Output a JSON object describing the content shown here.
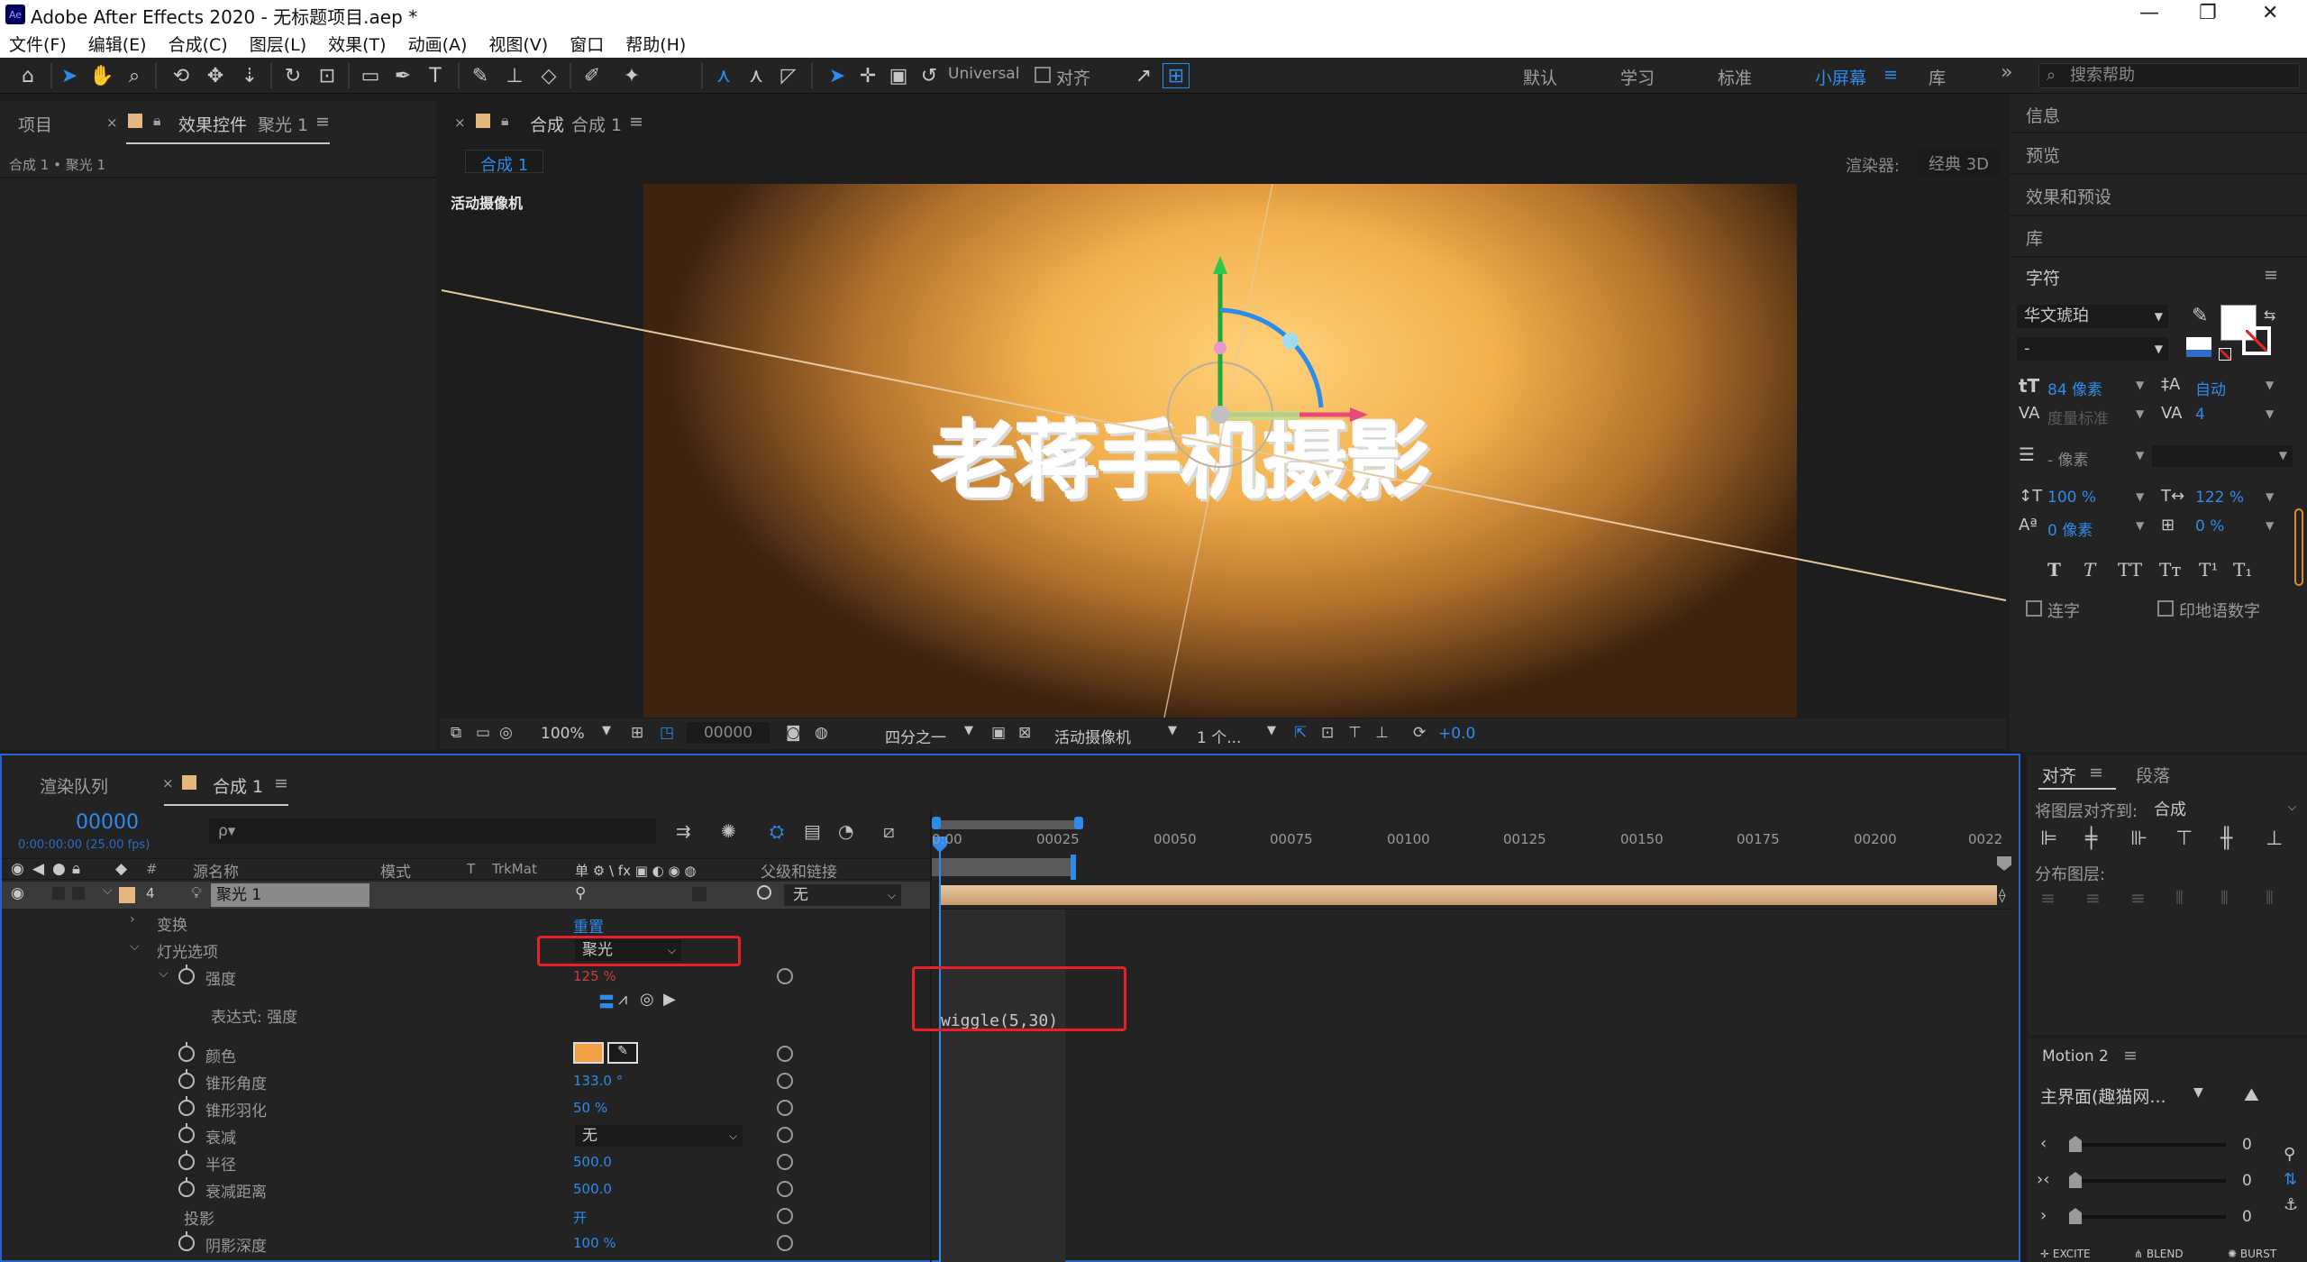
{
  "title_bar": {
    "app_icon": "Ae",
    "title": "Adobe After Effects 2020 - 无标题项目.aep *",
    "minimize": "—",
    "maximize": "❐",
    "close": "✕"
  },
  "menu": [
    "文件(F)",
    "编辑(E)",
    "合成(C)",
    "图层(L)",
    "效果(T)",
    "动画(A)",
    "视图(V)",
    "窗口",
    "帮助(H)"
  ],
  "toolbar": {
    "universal": "Universal",
    "align": "对齐",
    "workspaces": [
      "默认",
      "学习",
      "标准",
      "小屏幕",
      "库"
    ],
    "active_workspace_color": "#2d8ceb",
    "overflow": "»",
    "search_placeholder": "搜索帮助"
  },
  "left_panel": {
    "tabs": [
      "项目",
      "效果控件"
    ],
    "effect_target": "聚光 1",
    "breadcrumb": "合成 1 • 聚光 1"
  },
  "viewer": {
    "tab_label": "合成",
    "tab_comp": "合成 1",
    "comp_button": "合成 1",
    "renderer_label": "渲染器:",
    "renderer_value": "经典 3D",
    "camera_label": "活动摄像机",
    "comp_text": "老蒋手机摄影",
    "bottom": {
      "zoom": "100%",
      "timecode": "00000",
      "resolution": "四分之一",
      "camera": "活动摄像机",
      "views": "1 个...",
      "exposure": "+0.0"
    }
  },
  "right_panel": {
    "items": [
      "信息",
      "预览",
      "效果和预设",
      "库"
    ],
    "character": {
      "title": "字符",
      "font": "华文琥珀",
      "style": "-",
      "size": "84 像素",
      "leading": "自动",
      "kerning": "度量标准",
      "tracking": "4",
      "stroke": "- 像素",
      "vscale": "100 %",
      "hscale": "122 %",
      "baseline": "0 像素",
      "tsume": "0 %",
      "styles": [
        "T",
        "T",
        "TT",
        "Tт",
        "T¹",
        "T₁"
      ],
      "ligatures": "连字",
      "hindi": "印地语数字"
    }
  },
  "timeline": {
    "tabs": [
      "渲染队列",
      "合成 1"
    ],
    "timecode": "00000",
    "timecode_sub": "0:00:00:00 (25.00 fps)",
    "search_placeholder": "ρ▾",
    "headers": {
      "num": "#",
      "src": "源名称",
      "mode": "模式",
      "t": "T",
      "trkmat": "TrkMat",
      "switches": "单 ⚙ \\ fx ▣ ◐ ◉ ◍",
      "parent": "父级和链接"
    },
    "ruler": [
      "0:00",
      "00025",
      "00050",
      "00075",
      "00100",
      "00125",
      "00150",
      "00175",
      "00200",
      "0022"
    ],
    "layer": {
      "num": "4",
      "name": "聚光 1",
      "parent": "无"
    },
    "rows": [
      {
        "name": "变换",
        "value": "重置"
      },
      {
        "name": "灯光选项",
        "value": "聚光"
      },
      {
        "name": "强度",
        "value": "125 %"
      },
      {
        "name": "表达式: 强度",
        "value": ""
      },
      {
        "name": "颜色",
        "value": ""
      },
      {
        "name": "锥形角度",
        "value": "133.0 °"
      },
      {
        "name": "锥形羽化",
        "value": "50 %"
      },
      {
        "name": "衰减",
        "value": "无"
      },
      {
        "name": "半径",
        "value": "500.0"
      },
      {
        "name": "衰减距离",
        "value": "500.0"
      },
      {
        "name": "投影",
        "value": "开"
      },
      {
        "name": "阴影深度",
        "value": "100 %"
      }
    ],
    "expression": "wiggle(5,30)",
    "light_color": "#f0a040"
  },
  "align_panel": {
    "tabs": [
      "对齐",
      "段落"
    ],
    "align_to_label": "将图层对齐到:",
    "align_to_value": "合成",
    "distribute_label": "分布图层:"
  },
  "motion_panel": {
    "title": "Motion 2",
    "preset": "主界面(趣猫网...",
    "values": [
      "0",
      "0",
      "0"
    ],
    "buttons": [
      "EXCITE",
      "BLEND",
      "BURST"
    ]
  }
}
